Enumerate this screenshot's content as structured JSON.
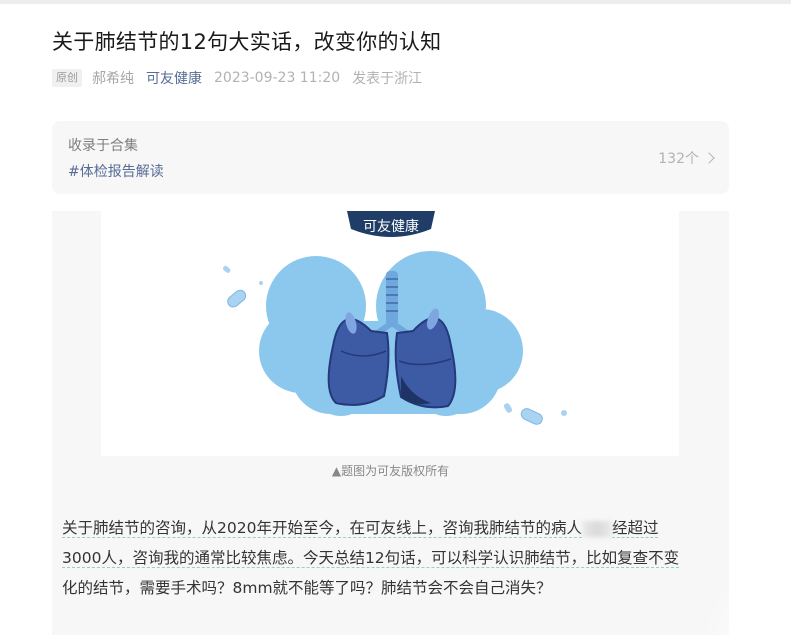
{
  "article": {
    "title": "关于肺结节的12句大实话，改变你的认知",
    "original_badge": "原创",
    "author": "郝希纯",
    "account_name": "可友健康",
    "publish_time": "2023-09-23 11:20",
    "location": "发表于浙江"
  },
  "collection": {
    "label": "收录于合集",
    "tag": "#体检报告解读",
    "count": "132个"
  },
  "figure": {
    "logo_text": "可友健康",
    "caption": "▲题图为可友版权所有"
  },
  "body": {
    "line1_a": "关于肺结节的咨询，从2020年开始至今，在可友线上，咨询我肺结节的病人",
    "line1_b": "经超过",
    "line2": "3000人，咨询我的通常比较焦虑。今天总结12句话，可以科学认识肺结节，比如复查不变",
    "line3": "化的结节，需要手术吗？8mm就不能等了吗？肺结节会不会自己消失？"
  },
  "colors": {
    "link_blue": "#576b95",
    "badge_navy": "#1f3d66",
    "cloud_blue": "#8cc8ee",
    "lung_blue": "#3d5aa5",
    "underline_teal": "#8fd3c9"
  }
}
